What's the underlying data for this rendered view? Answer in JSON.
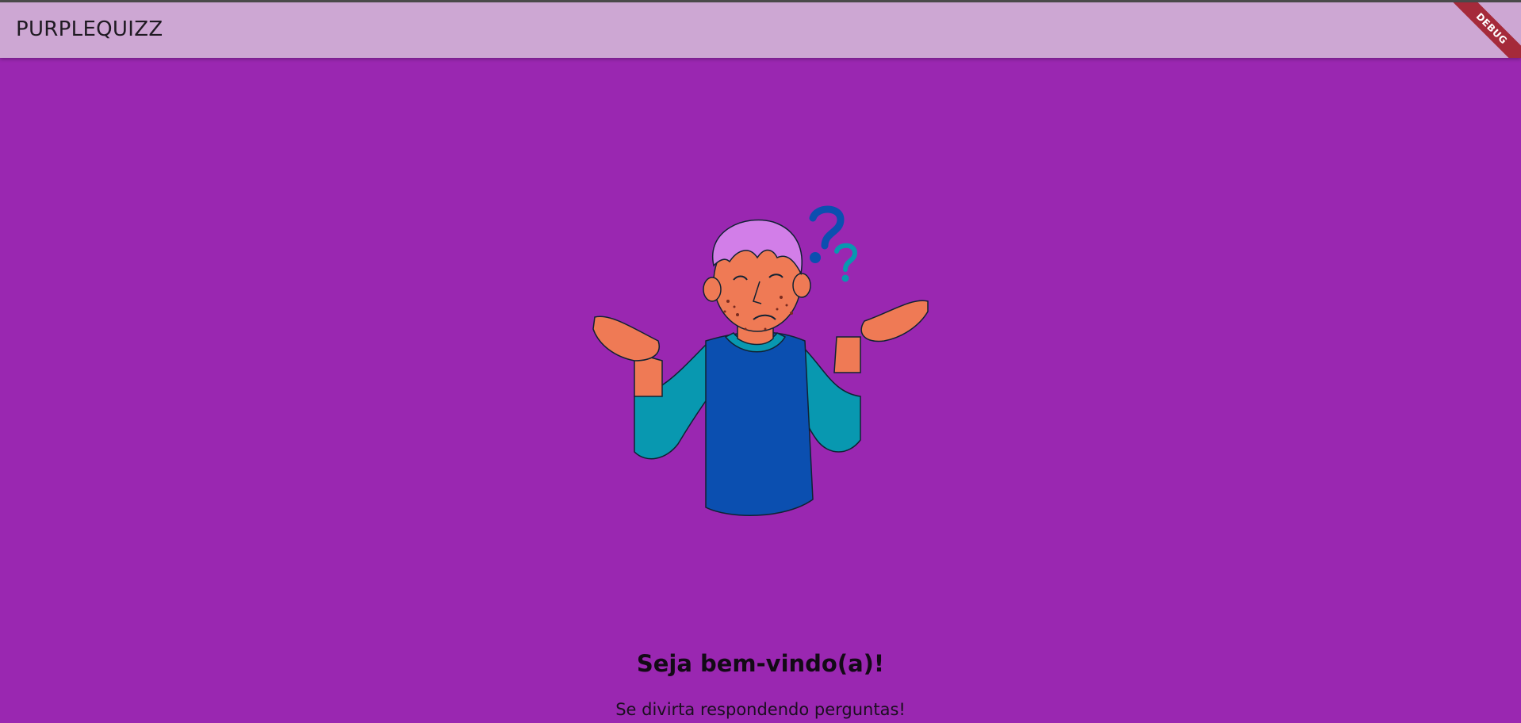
{
  "app_bar": {
    "title": "PURPLEQUIZZ",
    "debug_banner": "DEBUG"
  },
  "illustration": {
    "description_icon": "confused-person-illustration"
  },
  "welcome": {
    "title": "Seja bem-vindo(a)!",
    "subtitle": "Se divirta respondendo perguntas!"
  },
  "colors": {
    "background": "#9a27b1",
    "app_bar": "#cda7d3",
    "debug_ribbon": "#a52a3a"
  }
}
